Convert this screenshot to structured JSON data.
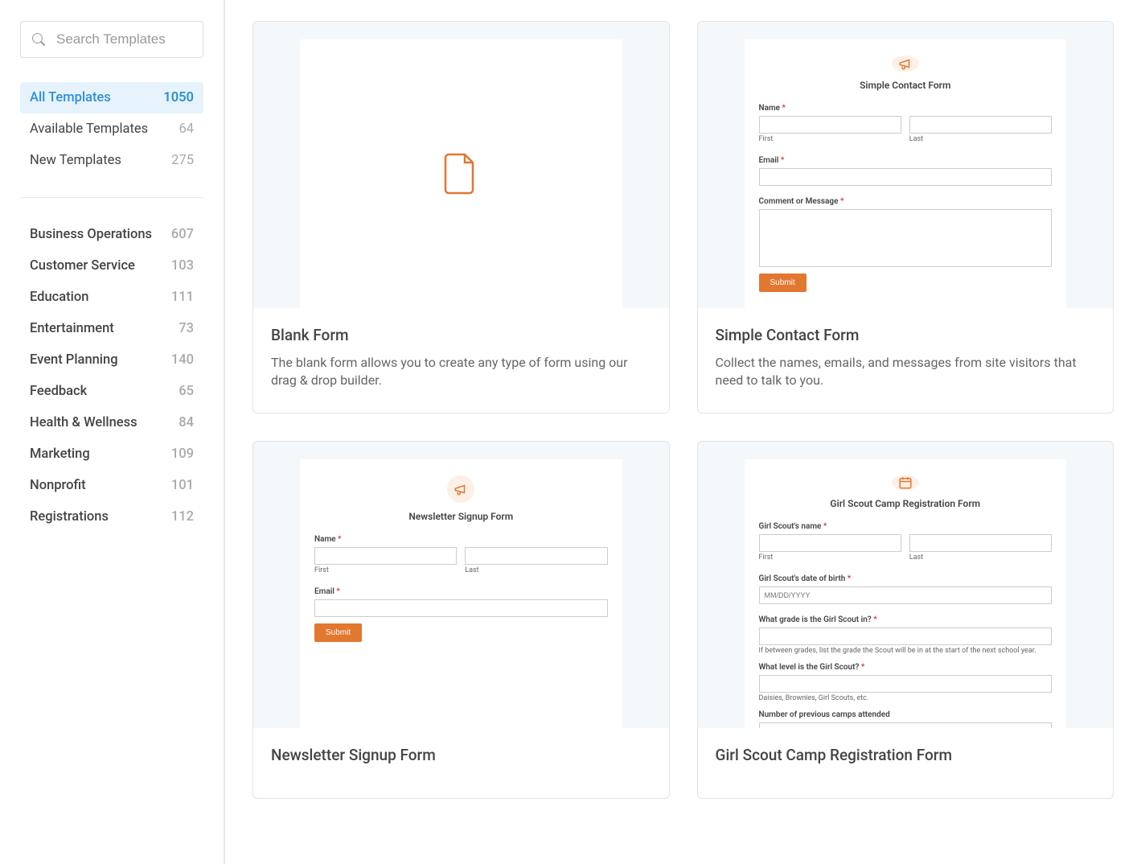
{
  "search": {
    "placeholder": "Search Templates"
  },
  "top_categories": [
    {
      "label": "All Templates",
      "count": "1050",
      "active": true
    },
    {
      "label": "Available Templates",
      "count": "64",
      "active": false
    },
    {
      "label": "New Templates",
      "count": "275",
      "active": false
    }
  ],
  "categories": [
    {
      "label": "Business Operations",
      "count": "607"
    },
    {
      "label": "Customer Service",
      "count": "103"
    },
    {
      "label": "Education",
      "count": "111"
    },
    {
      "label": "Entertainment",
      "count": "73"
    },
    {
      "label": "Event Planning",
      "count": "140"
    },
    {
      "label": "Feedback",
      "count": "65"
    },
    {
      "label": "Health & Wellness",
      "count": "84"
    },
    {
      "label": "Marketing",
      "count": "109"
    },
    {
      "label": "Nonprofit",
      "count": "101"
    },
    {
      "label": "Registrations",
      "count": "112"
    }
  ],
  "cards": {
    "blank": {
      "title": "Blank Form",
      "desc": "The blank form allows you to create any type of form using our drag & drop builder."
    },
    "contact": {
      "title": "Simple Contact Form",
      "desc": "Collect the names, emails, and messages from site visitors that need to talk to you.",
      "preview_title": "Simple Contact Form",
      "name_label": "Name",
      "first": "First",
      "last": "Last",
      "email_label": "Email",
      "comment_label": "Comment or Message",
      "submit": "Submit"
    },
    "newsletter": {
      "title": "Newsletter Signup Form",
      "preview_title": "Newsletter Signup Form",
      "name_label": "Name",
      "first": "First",
      "last": "Last",
      "email_label": "Email",
      "submit": "Submit"
    },
    "girlscout": {
      "title": "Girl Scout Camp Registration Form",
      "preview_title": "Girl Scout Camp Registration Form",
      "name_label": "Girl Scout's name",
      "first": "First",
      "last": "Last",
      "dob_label": "Girl Scout's date of birth",
      "dob_placeholder": "MM/DD/YYYY",
      "grade_label": "What grade is the Girl Scout in?",
      "grade_hint": "If between grades, list the grade the Scout will be in at the start of the next school year.",
      "level_label": "What level is the Girl Scout?",
      "level_hint": "Daisies, Brownies, Girl Scouts, etc.",
      "camps_label": "Number of previous camps attended"
    }
  }
}
